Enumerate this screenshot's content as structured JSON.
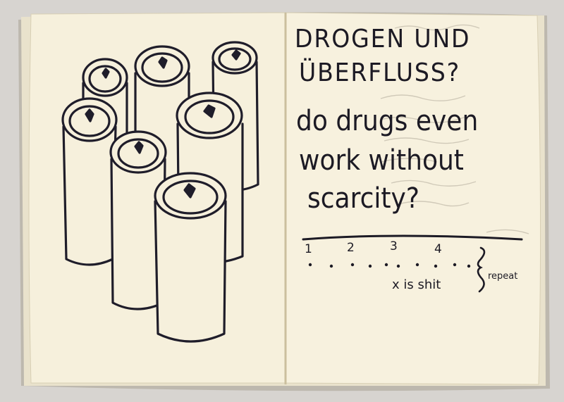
{
  "page": {
    "title_line1": "DROGEN UND",
    "title_line2": "ÜBERFLUSS?",
    "question_line1": "do drugs even",
    "question_line2": "work without",
    "question_line3": "scarcity?",
    "scale_ticks": [
      "1",
      "2",
      "3",
      "4"
    ],
    "note_text": "x is shit",
    "repeat_text": "repeat"
  },
  "sketch": {
    "subject": "beverage-cans",
    "can_count": 7,
    "ink_color": "#1f1d2a",
    "paper_color": "#f6f0dc"
  }
}
